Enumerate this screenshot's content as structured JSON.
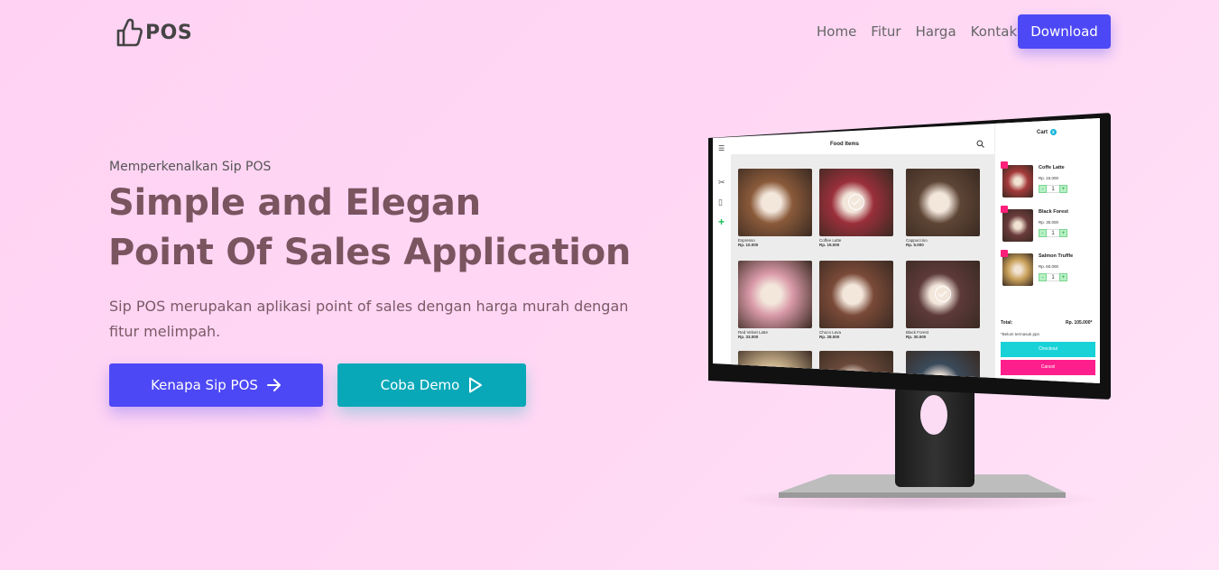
{
  "nav": {
    "brand": "POS",
    "links": [
      "Home",
      "Fitur",
      "Harga",
      "Kontak"
    ],
    "download_label": "Download"
  },
  "hero": {
    "intro": "Memperkenalkan Sip POS",
    "headline_line1": "Simple and Elegan",
    "headline_line2": "Point Of Sales Application",
    "description": "Sip POS merupakan aplikasi point of sales dengan harga murah dengan fitur melimpah.",
    "primary_cta": "Kenapa Sip POS",
    "secondary_cta": "Coba Demo"
  },
  "app_preview": {
    "title": "Food Items",
    "items": [
      {
        "name": "Espresso",
        "price": "Rp. 10.000",
        "color": "#8a5a3a",
        "selected": false
      },
      {
        "name": "Coffee Latte",
        "price": "Rp. 15.000",
        "color": "#9a2f3a",
        "selected": true
      },
      {
        "name": "Cappuccino",
        "price": "Rp. 5.000",
        "color": "#5e4535",
        "selected": false
      },
      {
        "name": "Red Velvet Latte",
        "price": "Rp. 33.000",
        "color": "#d99aa8",
        "selected": false
      },
      {
        "name": "Choco Lava",
        "price": "Rp. 28.000",
        "color": "#7a4a38",
        "selected": false
      },
      {
        "name": "Black Forest",
        "price": "Rp. 30.000",
        "color": "#5d3a3a",
        "selected": true
      },
      {
        "name": "",
        "price": "",
        "color": "#c8b08a",
        "selected": false
      },
      {
        "name": "",
        "price": "",
        "color": "#6a4a3a",
        "selected": true
      },
      {
        "name": "",
        "price": "",
        "color": "#3a4a5a",
        "selected": false
      }
    ],
    "cart": {
      "title": "Cart",
      "count": "3",
      "items": [
        {
          "name": "Coffe Latte",
          "price": "Rp. 15.000",
          "qty": "1",
          "color": "#a33a3a"
        },
        {
          "name": "Black Forest",
          "price": "Rp. 30.000",
          "qty": "1",
          "color": "#6a3b3b"
        },
        {
          "name": "Salmon Truffle",
          "price": "Rp. 60.000",
          "qty": "1",
          "color": "#c9a15a"
        }
      ],
      "total_label": "Total:",
      "total_value": "Rp. 105.000*",
      "note": "*Belum termasuk ppn",
      "checkout_label": "Checkout",
      "cancel_label": "Cancel"
    }
  }
}
